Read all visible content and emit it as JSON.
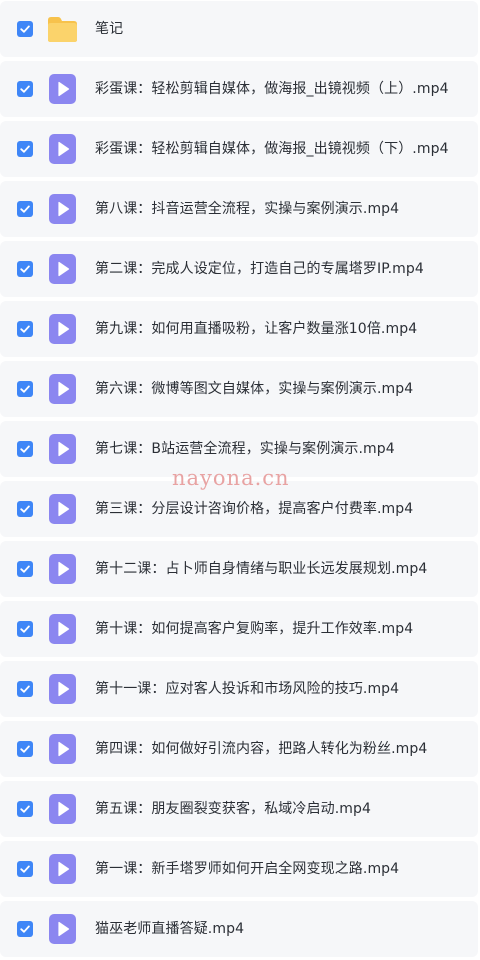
{
  "colors": {
    "row_background": "#f6f7f9",
    "checkbox_blue": "#3f86f7",
    "video_icon_purple": "#8b86f0",
    "folder_yellow": "#f7c24c",
    "text": "#2b2f36",
    "watermark": "#e8a3a3"
  },
  "items": [
    {
      "type": "folder",
      "icon": "folder-icon",
      "checked": true,
      "name": "笔记"
    },
    {
      "type": "video",
      "icon": "video-file-icon",
      "checked": true,
      "name": "彩蛋课：轻松剪辑自媒体，做海报_出镜视频（上）.mp4"
    },
    {
      "type": "video",
      "icon": "video-file-icon",
      "checked": true,
      "name": "彩蛋课：轻松剪辑自媒体，做海报_出镜视频（下）.mp4"
    },
    {
      "type": "video",
      "icon": "video-file-icon",
      "checked": true,
      "name": "第八课：抖音运营全流程，实操与案例演示.mp4"
    },
    {
      "type": "video",
      "icon": "video-file-icon",
      "checked": true,
      "name": "第二课：完成人设定位，打造自己的专属塔罗IP.mp4"
    },
    {
      "type": "video",
      "icon": "video-file-icon",
      "checked": true,
      "name": "第九课：如何用直播吸粉，让客户数量涨10倍.mp4"
    },
    {
      "type": "video",
      "icon": "video-file-icon",
      "checked": true,
      "name": "第六课：微博等图文自媒体，实操与案例演示.mp4"
    },
    {
      "type": "video",
      "icon": "video-file-icon",
      "checked": true,
      "name": "第七课：B站运营全流程，实操与案例演示.mp4"
    },
    {
      "type": "video",
      "icon": "video-file-icon",
      "checked": true,
      "name": "第三课：分层设计咨询价格，提高客户付费率.mp4"
    },
    {
      "type": "video",
      "icon": "video-file-icon",
      "checked": true,
      "name": "第十二课：占卜师自身情绪与职业长远发展规划.mp4"
    },
    {
      "type": "video",
      "icon": "video-file-icon",
      "checked": true,
      "name": "第十课：如何提高客户复购率，提升工作效率.mp4"
    },
    {
      "type": "video",
      "icon": "video-file-icon",
      "checked": true,
      "name": "第十一课：应对客人投诉和市场风险的技巧.mp4"
    },
    {
      "type": "video",
      "icon": "video-file-icon",
      "checked": true,
      "name": "第四课：如何做好引流内容，把路人转化为粉丝.mp4"
    },
    {
      "type": "video",
      "icon": "video-file-icon",
      "checked": true,
      "name": "第五课：朋友圈裂变获客，私域冷启动.mp4"
    },
    {
      "type": "video",
      "icon": "video-file-icon",
      "checked": true,
      "name": "第一课：新手塔罗师如何开启全网变现之路.mp4"
    },
    {
      "type": "video",
      "icon": "video-file-icon",
      "checked": true,
      "name": "猫巫老师直播答疑.mp4"
    }
  ],
  "watermark": "nayona.cn"
}
